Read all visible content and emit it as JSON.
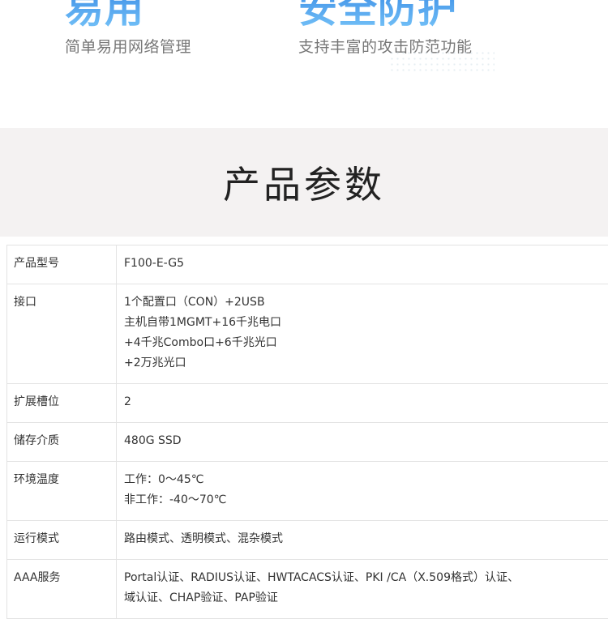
{
  "features": [
    {
      "title": "易用",
      "subtitle": "简单易用网络管理"
    },
    {
      "title": "安全防护",
      "subtitle": "支持丰富的攻击防范功能"
    }
  ],
  "section": {
    "title": "产品参数"
  },
  "specs": [
    {
      "key": "产品型号",
      "lines": [
        "F100-E-G5"
      ]
    },
    {
      "key": "接口",
      "lines": [
        "1个配置口（CON）+2USB",
        "主机自带1MGMT+16千兆电口",
        "+4千兆Combo口+6千兆光口",
        "+2万兆光口"
      ]
    },
    {
      "key": "扩展槽位",
      "lines": [
        "2"
      ]
    },
    {
      "key": "储存介质",
      "lines": [
        "480G SSD"
      ]
    },
    {
      "key": "环境温度",
      "lines": [
        "工作：0～45℃",
        "非工作：-40～70℃"
      ]
    },
    {
      "key": "运行模式",
      "lines": [
        "路由模式、透明模式、混杂模式"
      ]
    },
    {
      "key": "AAA服务",
      "lines": [
        "Portal认证、RADIUS认证、HWTACACS认证、PKI /CA（X.509格式）认证、",
        "域认证、CHAP验证、PAP验证"
      ]
    }
  ],
  "colors": {
    "feature_title": "#49a6f0",
    "section_bg": "#f4f2f2",
    "border": "#e3e3e3"
  }
}
